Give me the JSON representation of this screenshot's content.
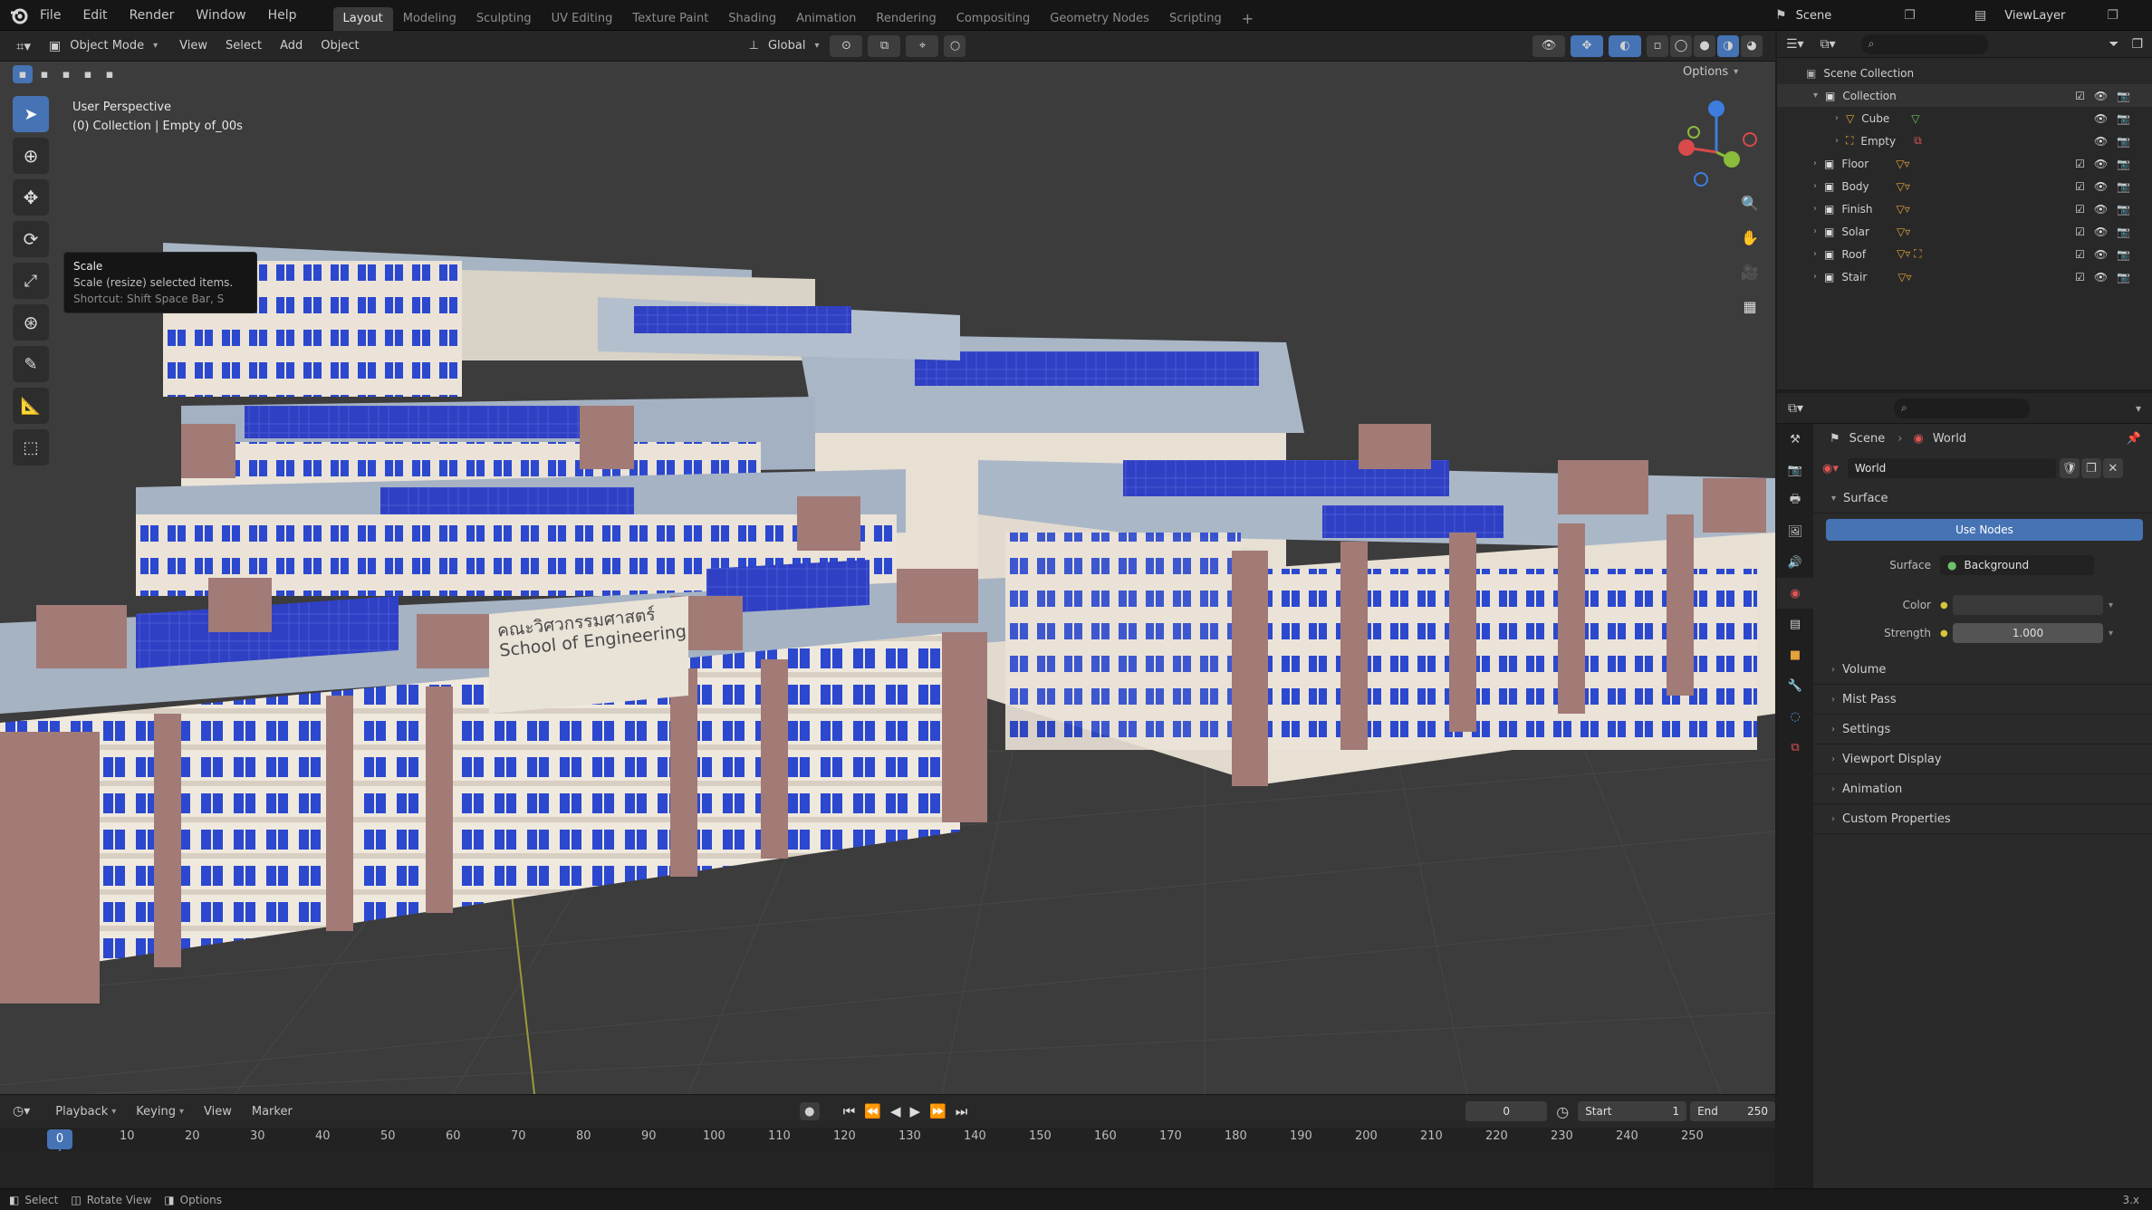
{
  "menu": {
    "items": [
      "File",
      "Edit",
      "Render",
      "Window",
      "Help"
    ]
  },
  "workspaces": [
    "Layout",
    "Modeling",
    "Sculpting",
    "UV Editing",
    "Texture Paint",
    "Shading",
    "Animation",
    "Rendering",
    "Compositing",
    "Geometry Nodes",
    "Scripting"
  ],
  "active_workspace": "Layout",
  "scene_label": "Scene",
  "viewlayer_label": "ViewLayer",
  "viewport": {
    "mode": "Object Mode",
    "menus": [
      "View",
      "Select",
      "Add",
      "Object"
    ],
    "transform_orientation": "Global",
    "options_label": "Options",
    "info_line1": "User Perspective",
    "info_line2": "(0) Collection | Empty of_00s",
    "tooltip_title": "Scale",
    "tooltip_desc": "Scale (resize) selected items.",
    "tooltip_shortcut": "Shortcut: Shift Space Bar, S",
    "sign_line1": "คณะวิศวกรรมศาสตร์",
    "sign_line2": "School of Engineering"
  },
  "outliner": {
    "search_placeholder": "",
    "scene_collection": "Scene Collection",
    "rows": [
      {
        "label": "Collection",
        "indent": 1
      },
      {
        "label": "Cube",
        "indent": 2
      },
      {
        "label": "Empty",
        "indent": 2
      },
      {
        "label": "Floor",
        "indent": 1
      },
      {
        "label": "Body",
        "indent": 1
      },
      {
        "label": "Finish",
        "indent": 1
      },
      {
        "label": "Solar",
        "indent": 1
      },
      {
        "label": "Roof",
        "indent": 1
      },
      {
        "label": "Stair",
        "indent": 1
      }
    ]
  },
  "properties": {
    "breadcrumb_scene": "Scene",
    "breadcrumb_world": "World",
    "world_name": "World",
    "surface_label": "Surface",
    "use_nodes_label": "Use Nodes",
    "surface_field_label": "Surface",
    "surface_value": "Background",
    "color_label": "Color",
    "strength_label": "Strength",
    "strength_value": "1.000",
    "sections": [
      "Volume",
      "Mist Pass",
      "Settings",
      "Viewport Display",
      "Animation",
      "Custom Properties"
    ]
  },
  "timeline": {
    "menus": [
      "Playback",
      "Keying",
      "View",
      "Marker"
    ],
    "current_frame": "0",
    "start_label": "Start",
    "start_value": "1",
    "end_label": "End",
    "end_value": "250",
    "frame_numbers": [
      "0",
      "20",
      "40",
      "60",
      "80",
      "100",
      "120",
      "140",
      "160",
      "180",
      "200",
      "220",
      "240"
    ],
    "frame_numbers_half": [
      "10",
      "30",
      "50",
      "70",
      "90",
      "110",
      "130",
      "150",
      "170",
      "190",
      "210",
      "230",
      "250"
    ]
  },
  "status": {
    "items": [
      "Select",
      "Rotate View",
      "Options"
    ],
    "version": "3.x"
  },
  "colors": {
    "accent": "#4673b4",
    "roof": "#a9b6c6",
    "wall": "#e7dfd3",
    "pillar": "#a27a76",
    "window": "#2d4cd0"
  }
}
